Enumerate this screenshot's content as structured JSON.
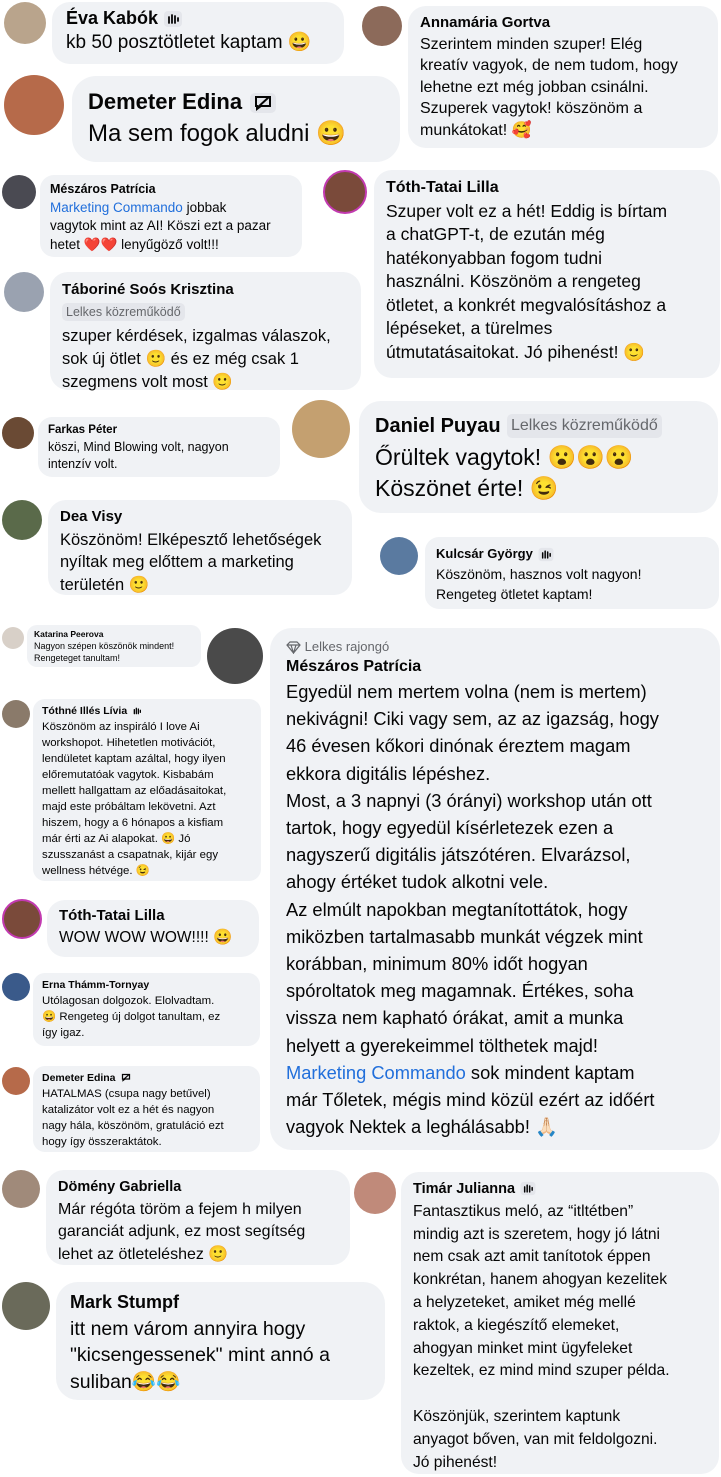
{
  "comments": [
    {
      "id": "c1",
      "name": "Éva Kabók",
      "text": "kb 50 posztötletet kaptam 😀",
      "icon": "wave-icon",
      "avatar": "#b9a48c"
    },
    {
      "id": "c2",
      "name": "Annamária Gortva",
      "text": "Szerintem minden szuper! Elég\nkreatív vagyok, de nem tudom, hogy\nlehetne ezt még jobban csinálni.\nSzuperek vagytok! köszönöm a\nmunkátokat! 🥰",
      "avatar": "#8c6a5a"
    },
    {
      "id": "c3",
      "name": "Demeter Edina",
      "text": "Ma sem fogok aludni 😀",
      "icon": "chat-icon",
      "avatar": "#b66a4a"
    },
    {
      "id": "c4",
      "name": "Mészáros Patrícia",
      "mention": "Marketing Commando",
      "text": " jobbak\nvagytok mint az AI! Köszi ezt a pazar\nhetet ❤️❤️ lenyűgöző volt!!!",
      "avatar": "#4a4a52"
    },
    {
      "id": "c5",
      "name": "Tóth-Tatai Lilla",
      "text": "Szuper volt ez a hét! Eddig is bírtam\na chatGPT-t, de ezután még\nhatékonyabban fogom tudni\nhasználni. Köszönöm a rengeteg\nötletet, a konkrét megvalósításhoz a\nlépéseket, a türelmes\nútmutatásaitokat. Jó pihenést! 🙂",
      "avatar": "#7a4a3a"
    },
    {
      "id": "c6",
      "name": "Táboriné Soós Krisztina",
      "badge": "Lelkes közreműködő",
      "text": "szuper kérdések, izgalmas válaszok,\nsok új ötlet 🙂 és ez még csak 1\nszegmens volt most 🙂",
      "avatar": "#9aa2b0"
    },
    {
      "id": "c7",
      "name": "Farkas Péter",
      "text": "köszi, Mind Blowing volt, nagyon\nintenzív volt.",
      "avatar": "#6a4a34"
    },
    {
      "id": "c8",
      "name": "Daniel Puyau",
      "badge": "Lelkes közreműködő",
      "text": "Őrültek vagytok! 😮😮😮\nKöszönet érte! 😉",
      "avatar": "#c4a070"
    },
    {
      "id": "c9",
      "name": "Dea Visy",
      "text": "Köszönöm! Elképesztő lehetőségek\nnyíltak meg előttem a marketing\nterületén 🙂",
      "avatar": "#5a6a4a"
    },
    {
      "id": "c10",
      "name": "Kulcsár György",
      "text": "Köszönöm, hasznos volt nagyon!\nRengeteg ötletet kaptam!",
      "icon": "wave-icon",
      "avatar": "#5a7aa0"
    },
    {
      "id": "c11",
      "name": "Katarina Peerova",
      "text": "Nagyon szépen köszönök mindent!\nRengeteget tanultam!",
      "avatar": "#d8d0c8"
    },
    {
      "id": "c12",
      "tag": "Lelkes rajongó",
      "name": "Mészáros Patrícia",
      "text": "Egyedül nem mertem volna (nem is mertem)\nnekivágni! Ciki vagy sem, az az igazság, hogy\n46 évesen kőkori dinónak éreztem magam\nekkora digitális lépéshez.\nMost, a 3 napnyi (3 órányi) workshop után ott\ntartok, hogy egyedül kísérletezek ezen a\nnagyszerű digitális játszótéren. Elvarázsol,\nahogy értéket tudok alkotni vele.\nAz elmúlt napokban megtanítottátok, hogy\nmiközben tartalmasabb munkát végzek mint\nkorábban, minimum 80% időt hogyan\nspóroltatok meg magamnak. Értékes, soha\nvissza nem kapható órákat, amit a munka\nhelyett a gyerekeimmel tölthetek majd!",
      "mention": "Marketing Commando",
      "text_after": " sok mindent kaptam\nmár Tőletek, mégis mind közül ezért az időért\nvagyok Nektek a leghálásabb! 🙏🏻",
      "avatar": "#4a4a4a"
    },
    {
      "id": "c13",
      "name": "Tóthné Illés Lívia",
      "text": "Köszönöm az inspiráló I love Ai\nworkshopot. Hihetetlen motivációt,\nlendületet kaptam azáltal, hogy ilyen\nelőremutatóak vagytok. Kisbabám\nmellett hallgattam az előadásaitokat,\nmajd este próbáltam lekövetni. Azt\nhiszem, hogy a 6 hónapos a kisfiam\nmár érti az Ai alapokat. 😀 Jó\nszusszanást a csapatnak, kijár egy\nwellness hétvége. 😉",
      "icon": "wave-icon",
      "avatar": "#8a7a6a"
    },
    {
      "id": "c14",
      "name": "Tóth-Tatai Lilla",
      "text": "WOW WOW WOW!!!! 😀",
      "avatar": "#7a4a3a"
    },
    {
      "id": "c15",
      "name": "Erna Thámm-Tornyay",
      "text": "Utólagosan dolgozok. Elolvadtam.\n😀 Rengeteg új dolgot tanultam, ez\nígy igaz.",
      "avatar": "#3a5a8a"
    },
    {
      "id": "c16",
      "name": "Demeter Edina",
      "text": "HATALMAS (csupa nagy betűvel)\nkatalizátor volt ez a hét és nagyon\nnagy hála, köszönöm, gratuláció ezt\nhogy így összeraktátok.",
      "icon": "chat-icon",
      "avatar": "#b66a4a"
    },
    {
      "id": "c17",
      "name": "Dömény Gabriella",
      "text": "Már régóta töröm a fejem h milyen\ngaranciát adjunk, ez most segítség\nlehet az ötleteléshez 🙂",
      "avatar": "#a08a7a"
    },
    {
      "id": "c18",
      "name": "Timár Julianna",
      "text": "Fantasztikus meló, az “itltétben”\nmindig azt is szeretem, hogy jó látni\nnem csak azt amit tanítotok éppen\nkonkrétan, hanem ahogyan kezelitek\na helyzeteket, amiket még mellé\nraktok, a kiegészítő elemeket,\nahogyan minket mint ügyfeleket\nkezeltek, ez mind mind szuper példa.\n\nKöszönjük, szerintem kaptunk\nanyagot bőven, van mit feldolgozni.\nJó pihenést!",
      "icon": "wave-icon",
      "avatar": "#c08a7a"
    },
    {
      "id": "c19",
      "name": "Mark Stumpf",
      "text": "itt nem várom annyira hogy\n\"kicsengessenek\" mint annó a\nsuliban😂😂",
      "avatar": "#6a6a5a"
    }
  ]
}
